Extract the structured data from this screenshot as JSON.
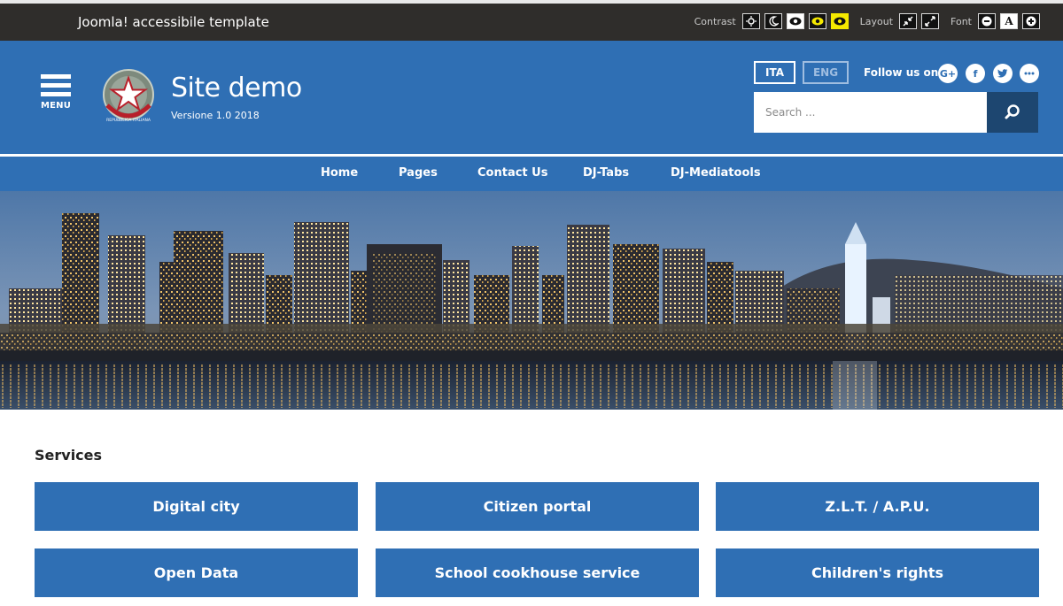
{
  "topbar": {
    "brand": "Joomla! accessibile template",
    "contrast_label": "Contrast",
    "layout_label": "Layout",
    "font_label": "Font"
  },
  "header": {
    "menu_label": "MENU",
    "site_title": "Site demo",
    "site_version": "Versione 1.0 2018",
    "emblem_text": "REPUBBLICA ITALIANA",
    "lang_ita": "ITA",
    "lang_eng": "ENG",
    "follow_label": "Follow us on:",
    "social": [
      "google-plus-icon",
      "facebook-icon",
      "twitter-icon",
      "more-icon"
    ],
    "search_placeholder": "Search ..."
  },
  "nav": {
    "items": [
      "Home",
      "Pages",
      "Contact Us",
      "DJ-Tabs",
      "DJ-Mediatools"
    ]
  },
  "services": {
    "title": "Services",
    "items": [
      "Digital city",
      "Citizen portal",
      "Z.L.T. / A.P.U.",
      "Open Data",
      "School cookhouse service",
      "Children's rights"
    ]
  },
  "colors": {
    "topbar_bg": "#2f2d2b",
    "primary_blue": "#2f6fb4",
    "search_button": "#1d4670"
  }
}
